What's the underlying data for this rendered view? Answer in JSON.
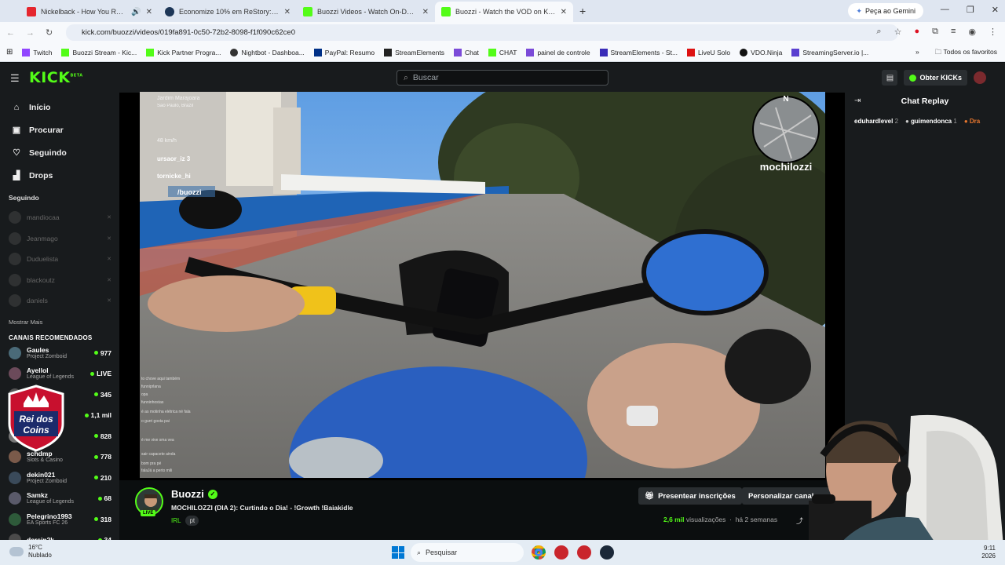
{
  "browser": {
    "tabs": [
      {
        "title": "Nickelback - How You Remember Me",
        "icon": "youtube-icon",
        "active": false
      },
      {
        "title": "Economize 10% em ReStory: Ch",
        "icon": "steam-icon",
        "active": false
      },
      {
        "title": "Buozzi Videos - Watch On-Demand",
        "icon": "kick-icon",
        "active": false
      },
      {
        "title": "Buozzi - Watch the VOD on Kick",
        "icon": "kick-icon",
        "active": true
      }
    ],
    "gemini_label": "Peça ao Gemini",
    "url": "kick.com/buozzi/videos/019fa891-0c50-72b2-8098-f1f090c62ce0",
    "bookmarks": [
      {
        "label": "Twitch",
        "icon": "twitch"
      },
      {
        "label": "Buozzi Stream - Kic...",
        "icon": "kick"
      },
      {
        "label": "Kick Partner Progra...",
        "icon": "kick"
      },
      {
        "label": "Nightbot - Dashboa...",
        "icon": "bot"
      },
      {
        "label": "PayPal: Resumo",
        "icon": "pp"
      },
      {
        "label": "StreamElements",
        "icon": "se"
      },
      {
        "label": "Chat",
        "icon": "purple"
      },
      {
        "label": "CHAT",
        "icon": "kick"
      },
      {
        "label": "painel de controle",
        "icon": "purple"
      },
      {
        "label": "StreamElements - St...",
        "icon": "se2"
      },
      {
        "label": "LiveU Solo",
        "icon": "liveu"
      },
      {
        "label": "VDO.Ninja",
        "icon": "vdo"
      },
      {
        "label": "StreamingServer.io |...",
        "icon": "ss"
      }
    ],
    "all_bookmarks_label": "Todos os favoritos"
  },
  "kick": {
    "logo": "KICK",
    "logo_sup": "BETA",
    "search_placeholder": "Buscar",
    "get_kicks_label": "Obter KICKs",
    "nav": [
      {
        "label": "Início",
        "icon": "home-icon"
      },
      {
        "label": "Procurar",
        "icon": "browse-icon"
      },
      {
        "label": "Seguindo",
        "icon": "heart-icon"
      },
      {
        "label": "Drops",
        "icon": "drops-icon"
      }
    ],
    "following_header": "Seguindo",
    "following": [
      "mandiocaa",
      "Jeanmago",
      "Duduelista",
      "blackoutz",
      "daniels"
    ],
    "show_more": "Mostrar Mais",
    "recommended_header": "CANAIS RECOMENDADOS",
    "recommended": [
      {
        "name": "Gaules",
        "category": "Project Zomboid",
        "viewers": "977"
      },
      {
        "name": "Ayellol",
        "category": "League of Legends",
        "viewers": "LIVE"
      },
      {
        "name": "",
        "category": "nds",
        "viewers": "345"
      },
      {
        "name": "",
        "category": "",
        "viewers": "1,1 mil"
      },
      {
        "name": "",
        "category": "",
        "viewers": "828"
      },
      {
        "name": "schdmp",
        "category": "Slots & Casino",
        "viewers": "778"
      },
      {
        "name": "dekin021",
        "category": "Project Zomboid",
        "viewers": "210"
      },
      {
        "name": "Samkz",
        "category": "League of Legends",
        "viewers": "68"
      },
      {
        "name": "Pelegrino1993",
        "category": "EA Sports FC 26",
        "viewers": "318"
      },
      {
        "name": "dersin2k",
        "category": "",
        "viewers": "34"
      }
    ],
    "badge": {
      "line1": "Rei dos",
      "line2": "Coins"
    },
    "chat": {
      "header": "Chat Replay",
      "gifters": [
        {
          "name": "eduhardlevel",
          "count": "2"
        },
        {
          "name": "guimendonca",
          "count": "1"
        },
        {
          "name": "Dra",
          "count": ""
        }
      ]
    },
    "video_overlay": {
      "compass": "N",
      "watermark": "mochilozzi",
      "location": "Jardim Marajoara",
      "city": "São Paulo, Brazil",
      "speed": "48 km/h",
      "users": [
        "ursaor_iz 3",
        "tornicke_hi"
      ],
      "handle": "/buozzi",
      "chat_lines": [
        "to chove aqui também",
        "funniprlana",
        "opa",
        "funninhostas",
        "é as motinha elétrica né fala",
        "o gurri gosta pai",
        "é me vive sma vea",
        "sair capacete ainda",
        "bom pra pé",
        "falaJá a perto mili"
      ]
    },
    "stream": {
      "name": "Buozzi",
      "live_label": "LIVE",
      "title": "MOCHILOZZI (DIA 2): Curtindo o Dia! - !Growth !Baiakidle",
      "category": "IRL",
      "language": "pt",
      "present_label": "Presentear inscrições",
      "customize_label": "Personalizar canal",
      "views": "2,6 mil",
      "views_suffix": "visualizações",
      "time_ago": "há 2 semanas"
    }
  },
  "taskbar": {
    "temp": "16°C",
    "weather": "Nublado",
    "search_placeholder": "Pesquisar",
    "time": "9:11",
    "date": "2026"
  }
}
